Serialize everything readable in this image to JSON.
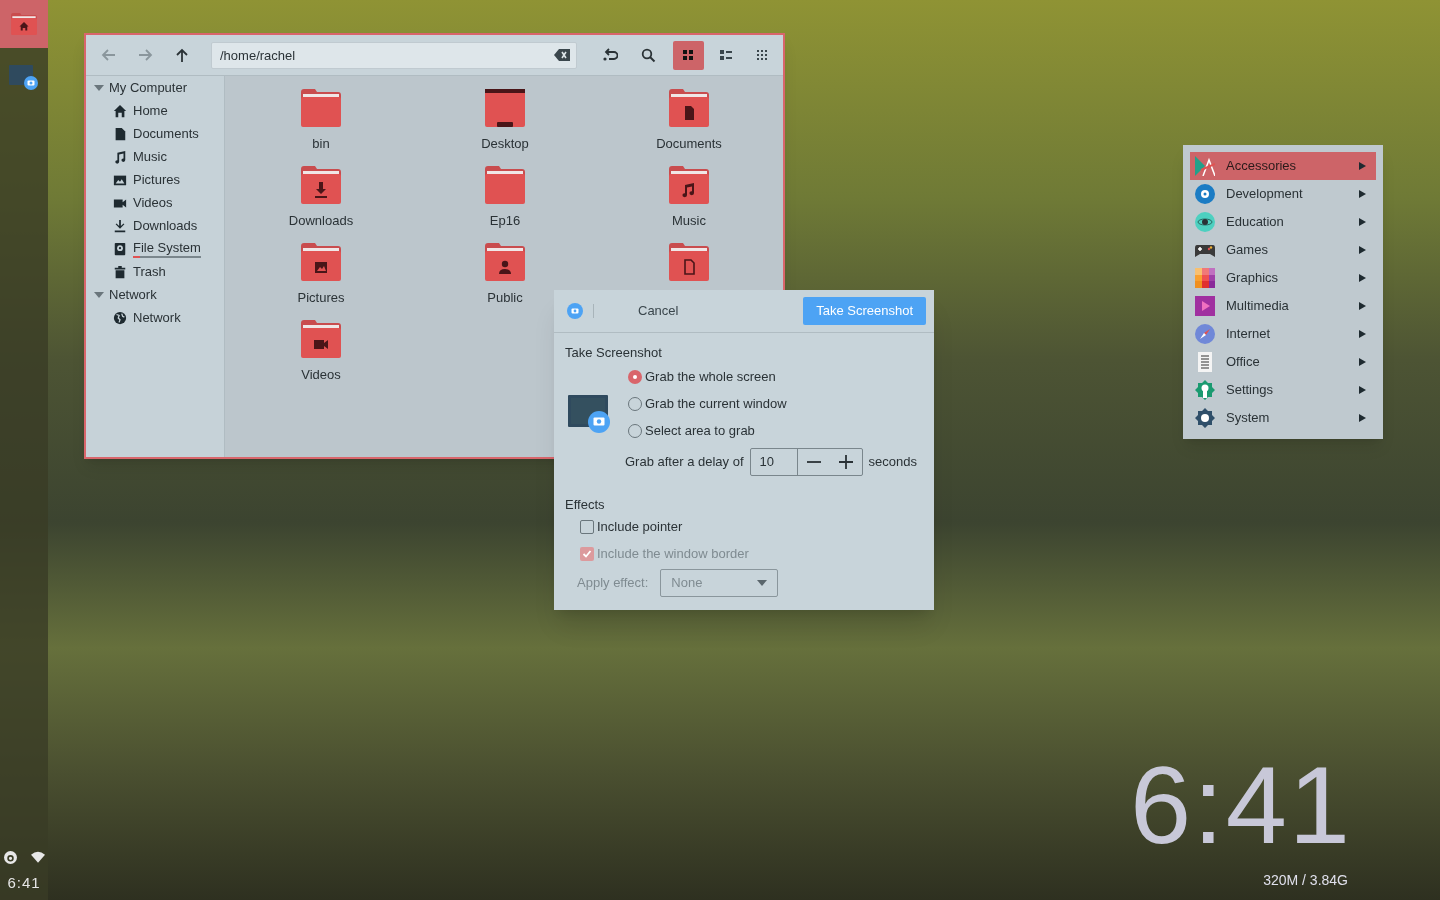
{
  "launcher": {
    "items": [
      {
        "kind": "home-folder",
        "selected": true
      },
      {
        "kind": "screenshot",
        "selected": false
      }
    ]
  },
  "tray": {
    "clock": "6:41"
  },
  "file_manager": {
    "nav_buttons": [
      {
        "kind": "back",
        "disabled": true
      },
      {
        "kind": "forward",
        "disabled": true
      },
      {
        "kind": "up",
        "disabled": false
      }
    ],
    "path": "/home/rachel",
    "tools": [
      {
        "kind": "jump"
      },
      {
        "kind": "search"
      }
    ],
    "view_modes": [
      {
        "kind": "icons",
        "selected": true
      },
      {
        "kind": "list",
        "selected": false
      },
      {
        "kind": "compact",
        "selected": false
      }
    ],
    "sidebar": [
      {
        "label": "My Computer",
        "expanded": true,
        "children": [
          {
            "label": "Home",
            "kind": "home"
          },
          {
            "label": "Documents",
            "kind": "document"
          },
          {
            "label": "Music",
            "kind": "music"
          },
          {
            "label": "Pictures",
            "kind": "picture"
          },
          {
            "label": "Videos",
            "kind": "video"
          },
          {
            "label": "Downloads",
            "kind": "download"
          },
          {
            "label": "File System",
            "kind": "drive",
            "level": 0.1
          },
          {
            "label": "Trash",
            "kind": "trash"
          }
        ]
      },
      {
        "label": "Network",
        "expanded": true,
        "children": [
          {
            "label": "Network",
            "kind": "globe"
          }
        ]
      }
    ],
    "files": [
      {
        "name": "bin",
        "kind": "plain"
      },
      {
        "name": "Desktop",
        "kind": "desktop"
      },
      {
        "name": "Documents",
        "kind": "document"
      },
      {
        "name": "Downloads",
        "kind": "download"
      },
      {
        "name": "Ep16",
        "kind": "plain"
      },
      {
        "name": "Music",
        "kind": "music"
      },
      {
        "name": "Pictures",
        "kind": "picture"
      },
      {
        "name": "Public",
        "kind": "person"
      },
      {
        "kind": "file"
      },
      {
        "name": "Videos",
        "kind": "video"
      }
    ]
  },
  "screenshot_dialog": {
    "cancel": "Cancel",
    "confirm": "Take Screenshot",
    "section_title": "Take Screenshot",
    "options": [
      {
        "label": "Grab the whole screen",
        "selected": true
      },
      {
        "label": "Grab the current window",
        "selected": false
      },
      {
        "label": "Select area to grab",
        "selected": false
      }
    ],
    "delay_label": "Grab after a delay of",
    "delay_value": "10",
    "delay_unit": "seconds",
    "effects_title": "Effects",
    "checkboxes": [
      {
        "label": "Include pointer",
        "checked": false,
        "disabled": false
      },
      {
        "label": "Include the window border",
        "checked": true,
        "disabled": true
      }
    ],
    "apply_effect_label": "Apply effect:",
    "apply_effect_value": "None",
    "apply_effect_disabled": true
  },
  "app_menu": [
    {
      "label": "Accessories",
      "kind": "accessories",
      "selected": true
    },
    {
      "label": "Development",
      "kind": "development",
      "selected": false
    },
    {
      "label": "Education",
      "kind": "education",
      "selected": false
    },
    {
      "label": "Games",
      "kind": "games",
      "selected": false
    },
    {
      "label": "Graphics",
      "kind": "graphics",
      "selected": false
    },
    {
      "label": "Multimedia",
      "kind": "multimedia",
      "selected": false
    },
    {
      "label": "Internet",
      "kind": "internet",
      "selected": false
    },
    {
      "label": "Office",
      "kind": "office",
      "selected": false
    },
    {
      "label": "Settings",
      "kind": "settings",
      "selected": false
    },
    {
      "label": "System",
      "kind": "system",
      "selected": false
    }
  ],
  "desktop_clock": {
    "time": "6:41",
    "memory": "320M / 3.84G"
  }
}
